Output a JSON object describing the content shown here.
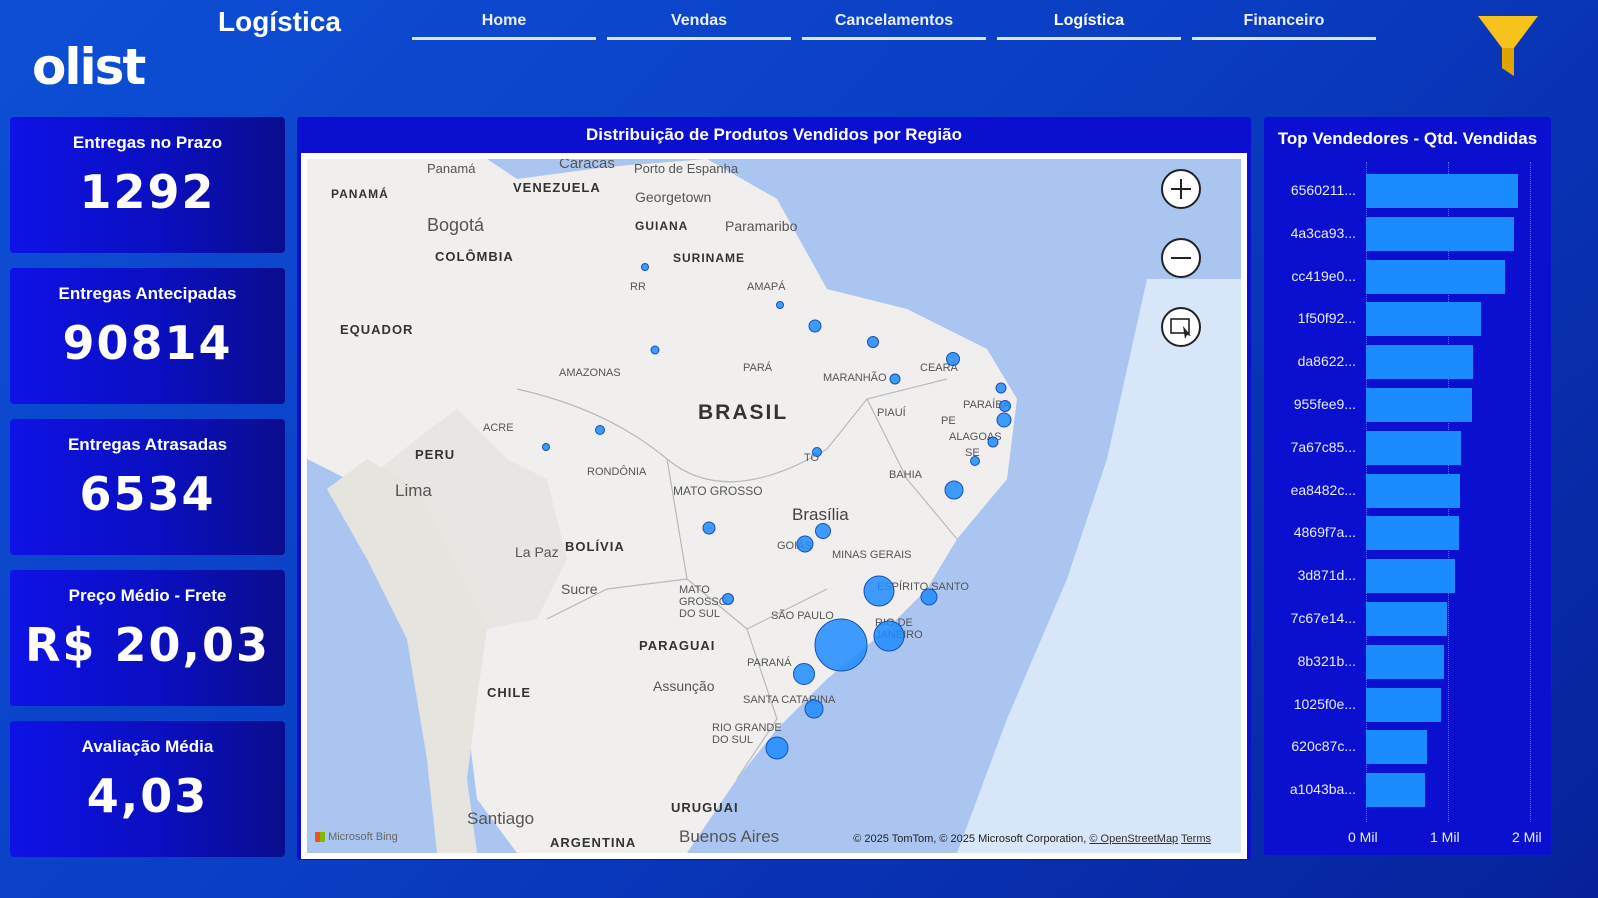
{
  "header": {
    "logo": "olist",
    "page_title": "Logística",
    "nav": [
      "Home",
      "Vendas",
      "Cancelamentos",
      "Logística",
      "Financeiro"
    ],
    "active_nav": "Logística",
    "filter_icon": "funnel-icon"
  },
  "kpis": [
    {
      "label": "Entregas no Prazo",
      "value": "1292"
    },
    {
      "label": "Entregas Antecipadas",
      "value": "90814"
    },
    {
      "label": "Entregas Atrasadas",
      "value": "6534"
    },
    {
      "label": "Preço Médio - Frete",
      "value": "R$ 20,03"
    },
    {
      "label": "Avaliação Média",
      "value": "4,03"
    }
  ],
  "map": {
    "title": "Distribuição de Produtos Vendidos por Região",
    "provider": "Microsoft Bing",
    "attribution": "© 2025 TomTom, © 2025 Microsoft Corporation,",
    "osm_link": "© OpenStreetMap",
    "terms_link": "Terms",
    "controls": [
      "zoom-in-icon",
      "zoom-out-icon",
      "select-area-icon"
    ],
    "labels": [
      "PANAMÁ",
      "Panamá",
      "Caracas",
      "Porto de Espanha",
      "VENEZUELA",
      "Georgetown",
      "GUIANA",
      "Paramaribo",
      "SURINAME",
      "Bogotá",
      "COLÔMBIA",
      "EQUADOR",
      "RR",
      "AMAPÁ",
      "AMAZONAS",
      "PARÁ",
      "MARANHÃO",
      "CEARÁ",
      "BRASIL",
      "PIAUÍ",
      "PARAÍBA",
      "PE",
      "ALAGOAS",
      "SE",
      "ACRE",
      "TO",
      "PERU",
      "RONDÔNIA",
      "BAHIA",
      "Lima",
      "MATO GROSSO",
      "Brasília",
      "GOIÁS",
      "La Paz",
      "BOLÍVIA",
      "MINAS GERAIS",
      "ESPÍRITO SANTO",
      "Sucre",
      "MATO GROSSO DO SUL",
      "SÃO PAULO",
      "RIO DE JANEIRO",
      "PARAGUAI",
      "PARANÁ",
      "Assunção",
      "CHILE",
      "SANTA CATARINA",
      "RIO GRANDE DO SUL",
      "URUGUAI",
      "Santiago",
      "Buenos Aires",
      "ARGENTINA"
    ]
  },
  "top_sellers": {
    "title": "Top Vendedores - Qtd. Vendidas",
    "axis_ticks": [
      "0 Mil",
      "1 Mil",
      "2 Mil"
    ],
    "sellers": [
      "6560211...",
      "4a3ca93...",
      "cc419e0...",
      "1f50f92...",
      "da8622...",
      "955fee9...",
      "7a67c85...",
      "ea8482c...",
      "4869f7a...",
      "3d871d...",
      "7c67e14...",
      "8b321b...",
      "1025f0e...",
      "620c87c...",
      "a1043ba..."
    ]
  },
  "chart_data": {
    "type": "bar",
    "orientation": "horizontal",
    "title": "Top Vendedores - Qtd. Vendidas",
    "categories": [
      "6560211...",
      "4a3ca93...",
      "cc419e0...",
      "1f50f92...",
      "da8622...",
      "955fee9...",
      "7a67c85...",
      "ea8482c...",
      "4869f7a...",
      "3d871d...",
      "7c67e14...",
      "8b321b...",
      "1025f0e...",
      "620c87c...",
      "a1043ba..."
    ],
    "values": [
      1850,
      1800,
      1700,
      1400,
      1310,
      1290,
      1160,
      1150,
      1130,
      1080,
      990,
      950,
      920,
      740,
      720
    ],
    "xlim": [
      0,
      2000
    ],
    "xticks": [
      "0 Mil",
      "1 Mil",
      "2 Mil"
    ],
    "grid": true
  },
  "colors": {
    "accent": "#1a8cff",
    "card": "#0f12e6",
    "background": "#0a3fc4"
  }
}
